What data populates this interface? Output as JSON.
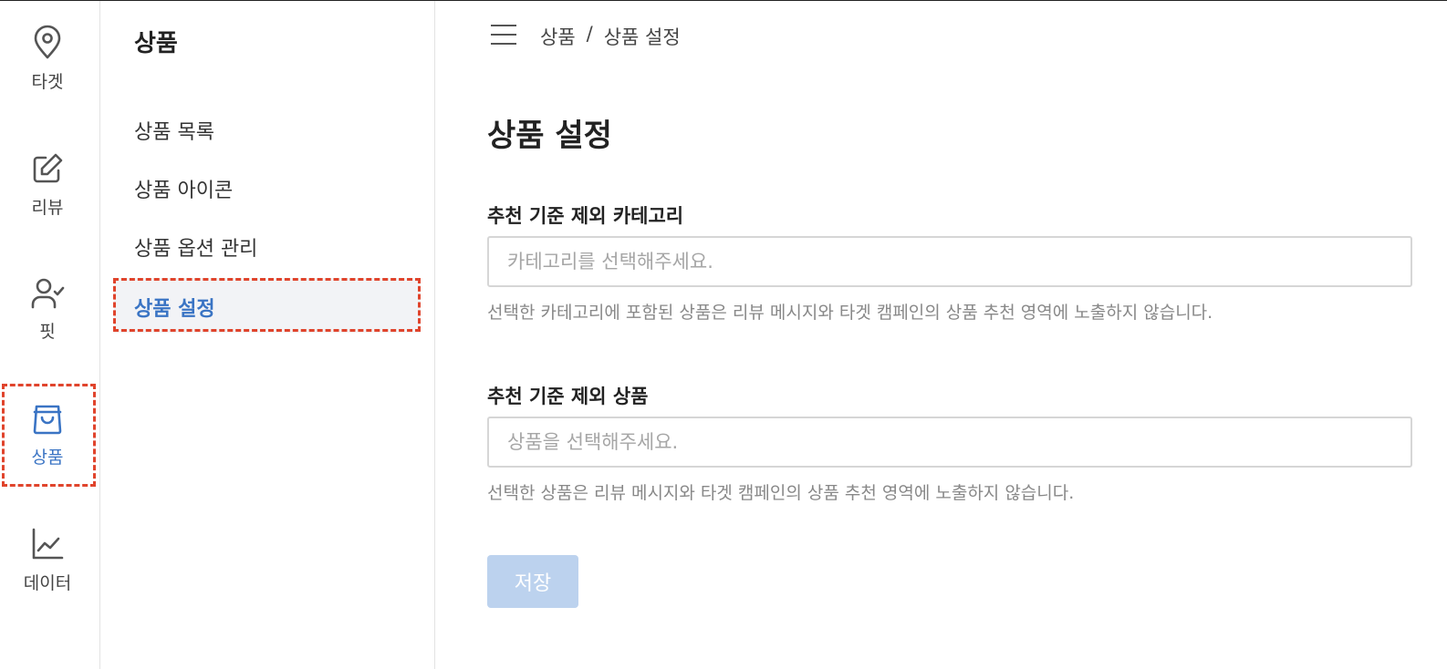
{
  "rail": {
    "items": [
      {
        "label": "타겟",
        "icon": "location-pin-icon"
      },
      {
        "label": "리뷰",
        "icon": "edit-icon"
      },
      {
        "label": "핏",
        "icon": "user-check-icon"
      },
      {
        "label": "상품",
        "icon": "shopping-bag-icon",
        "active": true
      },
      {
        "label": "데이터",
        "icon": "line-chart-icon"
      }
    ]
  },
  "subnav": {
    "title": "상품",
    "items": [
      {
        "label": "상품 목록"
      },
      {
        "label": "상품 아이콘"
      },
      {
        "label": "상품 옵션 관리"
      },
      {
        "label": "상품 설정",
        "active": true
      }
    ]
  },
  "breadcrumb": {
    "parent": "상품",
    "separator": "/",
    "current": "상품 설정"
  },
  "page": {
    "title": "상품 설정"
  },
  "form": {
    "category": {
      "label": "추천 기준 제외 카테고리",
      "placeholder": "카테고리를 선택해주세요.",
      "value": "",
      "help": "선택한 카테고리에 포함된 상품은 리뷰 메시지와 타겟 캠페인의 상품 추천 영역에 노출하지 않습니다."
    },
    "product": {
      "label": "추천 기준 제외 상품",
      "placeholder": "상품을 선택해주세요.",
      "value": "",
      "help": "선택한 상품은 리뷰 메시지와 타겟 캠페인의 상품 추천 영역에 노출하지 않습니다."
    },
    "save_label": "저장"
  },
  "colors": {
    "accent": "#3a74c4",
    "highlight_outline": "#e0442c",
    "save_disabled": "#bcd2ee",
    "active_bg": "#f2f3f6"
  }
}
